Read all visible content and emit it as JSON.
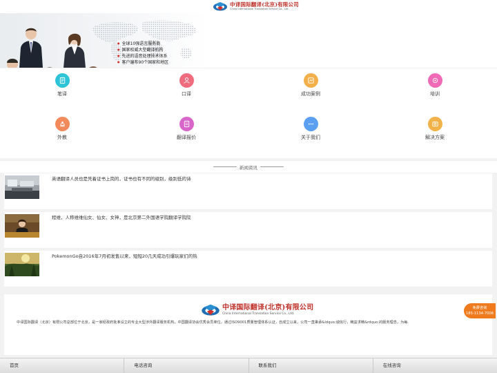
{
  "header": {
    "logo_cn": "中译国际翻译(北京)有限公司",
    "logo_en": "China International Translation Service Co., Ltd."
  },
  "banner": {
    "points": [
      "全球10强语言服务商",
      "国家权威大型翻译机构",
      "先进的语音处理技术体系",
      "客户遍布90个国家和地区"
    ]
  },
  "services": [
    {
      "label": "笔译",
      "color": "#2ec3d6",
      "icon": "document-icon"
    },
    {
      "label": "口译",
      "color": "#ef6b7e",
      "icon": "person-icon"
    },
    {
      "label": "成功案例",
      "color": "#f3b04a",
      "icon": "case-icon"
    },
    {
      "label": "培训",
      "color": "#f06ab6",
      "icon": "training-icon"
    },
    {
      "label": "外教",
      "color": "#f28a5c",
      "icon": "teacher-icon"
    },
    {
      "label": "翻译报价",
      "color": "#d865c8",
      "icon": "price-icon"
    },
    {
      "label": "关于我们",
      "color": "#5a9ff2",
      "icon": "more-icon"
    },
    {
      "label": "解决方案",
      "color": "#f2b24a",
      "icon": "solution-icon"
    }
  ],
  "news": {
    "title": "新闻资讯",
    "items": [
      {
        "text": "英语翻译人员也是凭着证书上岗的，证书也有不同的级别，级别低的诗"
      },
      {
        "text": "程维，人称维维仙女、仙女、女神，是北京第二外国语学院翻译学院院"
      },
      {
        "text": "PokemonGo自2016年7月初发售以来，短短20几天成功引爆玩家们的热"
      }
    ]
  },
  "footer": {
    "logo_cn": "中译国际翻译(北京)有限公司",
    "logo_en": "China International Translation Service Co., Ltd.",
    "desc": "中译国际翻译（北京）有限公司总部位于北京，是一家经政府批准设立的专业大型涉外翻译服务机构，中国翻译协会优秀会员单位，通过ISO9001质量管理体系认证，自成立以来，公司一直秉承&ldquo;诚信行，精益求精&rdquo;的服务理念，为每."
  },
  "float_badge": {
    "line1": "免费咨询",
    "line2": "185-1134-7006"
  },
  "bottom_nav": [
    "首页",
    "电话咨询",
    "联系我们",
    "在线咨询"
  ]
}
